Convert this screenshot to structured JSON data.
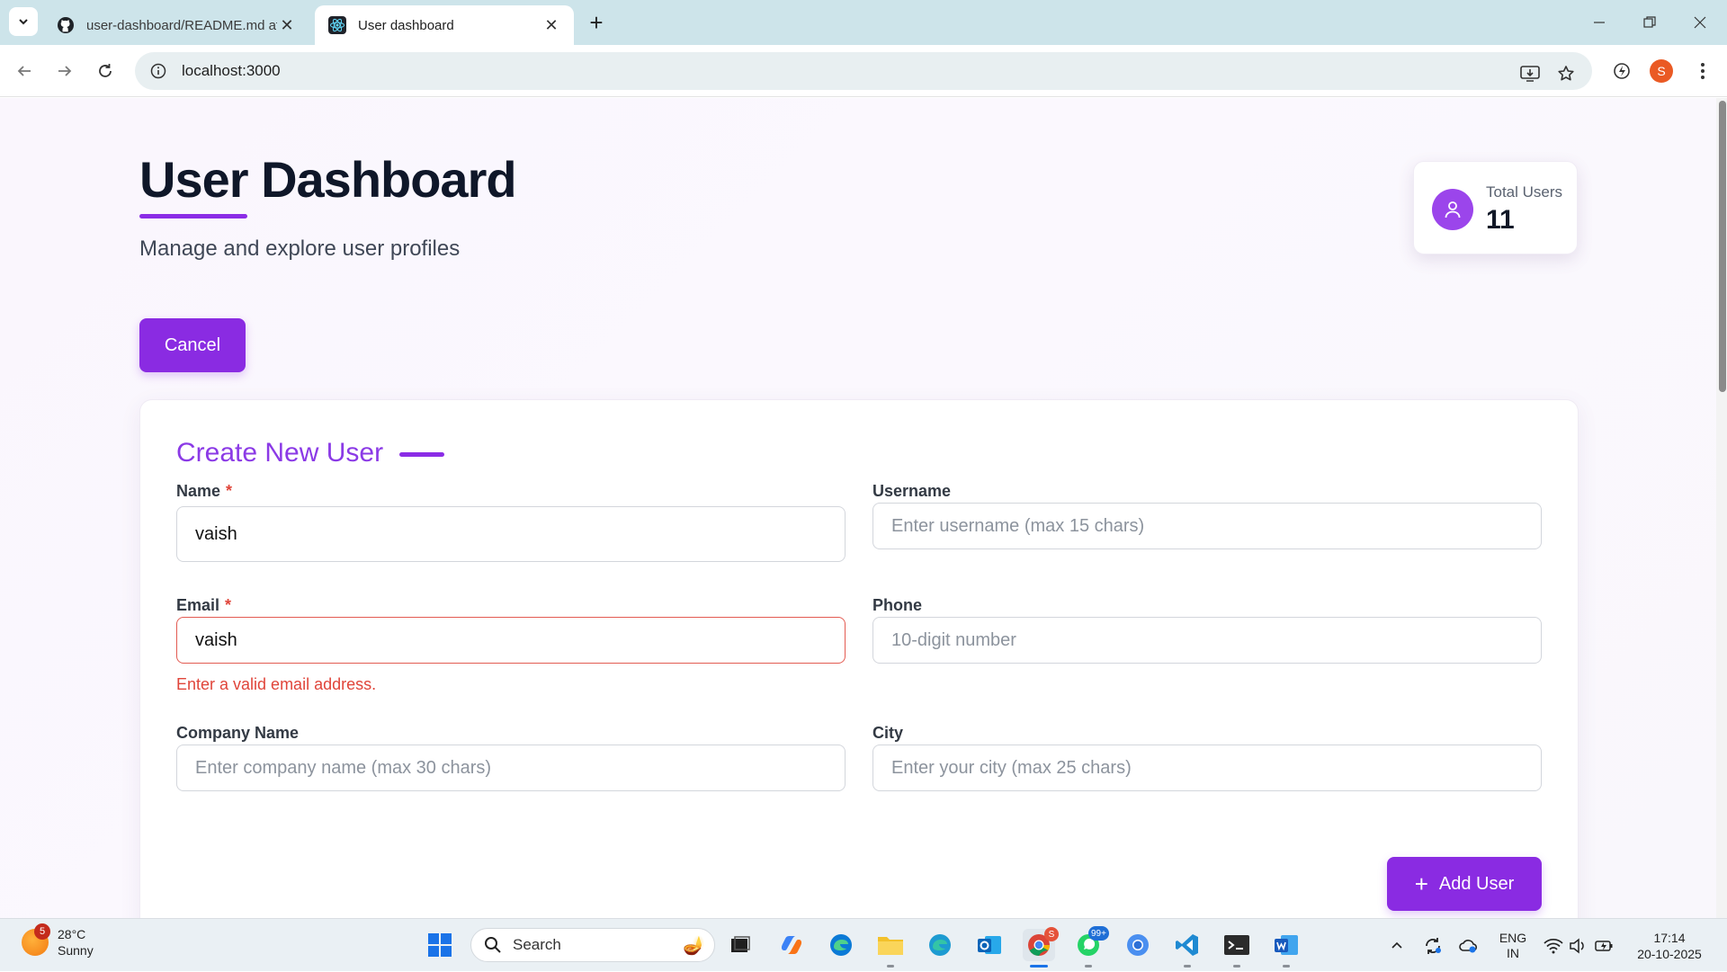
{
  "browser": {
    "tabs": [
      {
        "title": "user-dashboard/README.md at",
        "icon": "github-icon",
        "active": false
      },
      {
        "title": "User dashboard",
        "icon": "react-icon",
        "active": true
      }
    ],
    "url": "localhost:3000",
    "profile_initial": "S"
  },
  "header": {
    "title": "User Dashboard",
    "subtitle": "Manage and explore user profiles"
  },
  "stats": {
    "label": "Total Users",
    "value": "11"
  },
  "actions": {
    "cancel_label": "Cancel",
    "add_label": "Add User"
  },
  "form": {
    "title": "Create New User",
    "required_mark": "*",
    "fields": {
      "name": {
        "label": "Name",
        "value": "vaish",
        "placeholder": ""
      },
      "username": {
        "label": "Username",
        "value": "",
        "placeholder": "Enter username (max 15 chars)"
      },
      "email": {
        "label": "Email",
        "value": "vaish",
        "placeholder": "",
        "error": "Enter a valid email address."
      },
      "phone": {
        "label": "Phone",
        "value": "",
        "placeholder": "10-digit number"
      },
      "company": {
        "label": "Company Name",
        "value": "",
        "placeholder": "Enter company name (max 30 chars)"
      },
      "city": {
        "label": "City",
        "value": "",
        "placeholder": "Enter your city (max 25 chars)"
      }
    }
  },
  "taskbar": {
    "weather_temp": "28°C",
    "weather_desc": "Sunny",
    "weather_badge": "5",
    "search_label": "Search",
    "chrome_badge": "S",
    "whatsapp_badge": "99+",
    "lang": "ENG",
    "region": "IN",
    "time": "17:14",
    "date": "20-10-2025"
  },
  "colors": {
    "accent": "#8a2be2",
    "error": "#e0453a",
    "heading": "#0f1729"
  }
}
